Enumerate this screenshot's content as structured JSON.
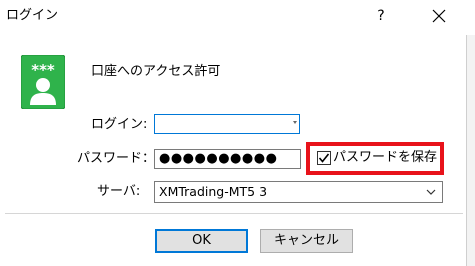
{
  "window": {
    "title": "ログイン",
    "help_label": "?"
  },
  "header": {
    "text": "口座へのアクセス許可",
    "icon": "user-account-icon",
    "icon_glyph": "***"
  },
  "form": {
    "login_label": "ログイン:",
    "login_value": "",
    "password_label": "パスワード：",
    "password_value": "●●●●●●●●●●",
    "save_password_label": "パスワードを保存",
    "save_password_checked": true,
    "server_label": "サーバ:",
    "server_value": "XMTrading-MT5 3"
  },
  "buttons": {
    "ok_label": "OK",
    "cancel_label": "キャンセル"
  },
  "colors": {
    "icon_green": "#2fb34b",
    "highlight_red": "#e8121a",
    "focus_blue": "#0078d7"
  }
}
